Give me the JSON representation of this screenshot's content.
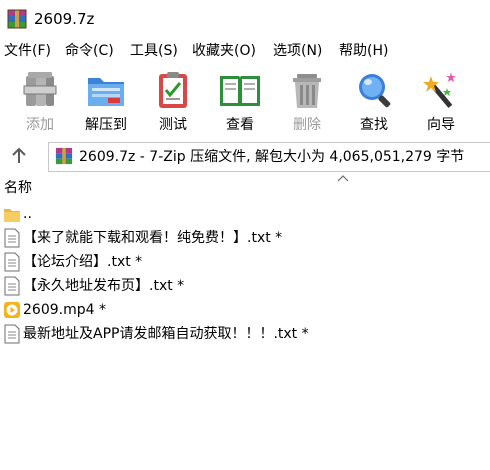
{
  "window": {
    "title": "2609.7z"
  },
  "menu": [
    {
      "label": "文件(F)"
    },
    {
      "label": "命令(C)"
    },
    {
      "label": "工具(S)"
    },
    {
      "label": "收藏夹(O)"
    },
    {
      "label": "选项(N)"
    },
    {
      "label": "帮助(H)"
    }
  ],
  "toolbar": [
    {
      "label": "添加",
      "icon": "add-archive-icon",
      "enabled": false
    },
    {
      "label": "解压到",
      "icon": "extract-folder-icon",
      "enabled": true
    },
    {
      "label": "测试",
      "icon": "test-clipboard-icon",
      "enabled": true
    },
    {
      "label": "查看",
      "icon": "view-book-icon",
      "enabled": true
    },
    {
      "label": "删除",
      "icon": "trash-icon",
      "enabled": false
    },
    {
      "label": "查找",
      "icon": "magnifier-icon",
      "enabled": true
    },
    {
      "label": "向导",
      "icon": "wizard-wand-icon",
      "enabled": true
    }
  ],
  "address": {
    "text": "2609.7z - 7-Zip 压缩文件, 解包大小为 4,065,051,279 字节"
  },
  "columns": {
    "name": "名称"
  },
  "files": [
    {
      "name": "..",
      "icon": "folder-icon"
    },
    {
      "name": "【来了就能下载和观看！纯免费！】.txt *",
      "icon": "text-file-icon"
    },
    {
      "name": "【论坛介绍】.txt *",
      "icon": "text-file-icon"
    },
    {
      "name": "【永久地址发布页】.txt *",
      "icon": "text-file-icon"
    },
    {
      "name": "2609.mp4 *",
      "icon": "video-file-icon"
    },
    {
      "name": "最新地址及APP请发邮箱自动获取！！！.txt *",
      "icon": "text-file-icon"
    }
  ],
  "colors": {
    "disabled_text": "#9a9a9a",
    "video_icon": "#f5b21b"
  }
}
